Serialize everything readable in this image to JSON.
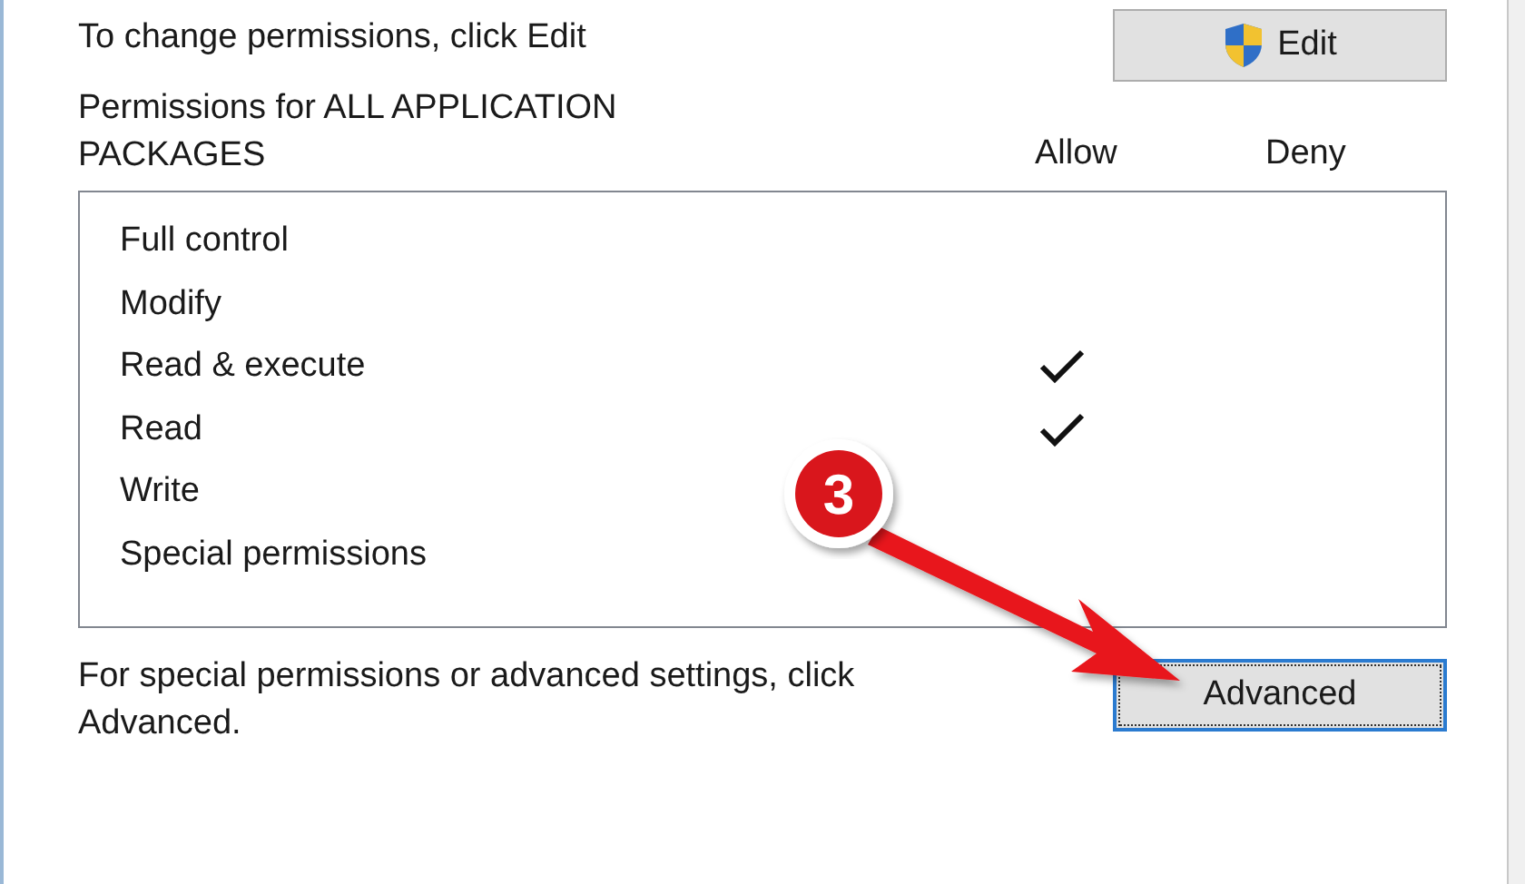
{
  "instruction": "To change permissions, click Edit",
  "edit_button": {
    "label": "Edit"
  },
  "permissions_for": "Permissions for ALL APPLICATION PACKAGES",
  "columns": [
    "Allow",
    "Deny"
  ],
  "permissions": [
    {
      "name": "Full control",
      "allow": false,
      "deny": false
    },
    {
      "name": "Modify",
      "allow": false,
      "deny": false
    },
    {
      "name": "Read & execute",
      "allow": true,
      "deny": false
    },
    {
      "name": "Read",
      "allow": true,
      "deny": false
    },
    {
      "name": "Write",
      "allow": false,
      "deny": false
    },
    {
      "name": "Special permissions",
      "allow": false,
      "deny": false
    }
  ],
  "advanced_hint": "For special permissions or advanced settings, click Advanced.",
  "advanced_button": {
    "label": "Advanced",
    "focused": true
  },
  "annotation": {
    "step": "3"
  }
}
